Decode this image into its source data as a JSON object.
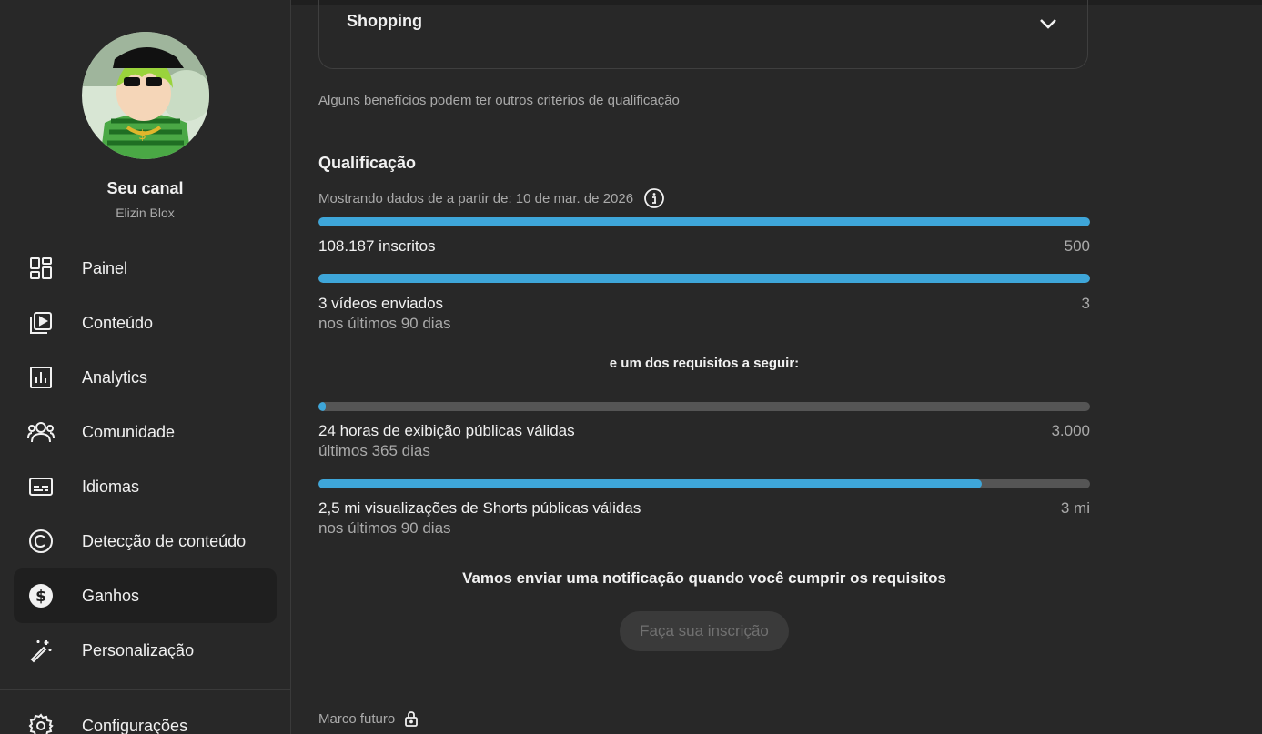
{
  "sidebar": {
    "channel_title": "Seu canal",
    "channel_name": "Elizin Blox",
    "items": [
      {
        "label": "Painel",
        "icon": "dashboard-icon"
      },
      {
        "label": "Conteúdo",
        "icon": "content-icon"
      },
      {
        "label": "Analytics",
        "icon": "analytics-icon"
      },
      {
        "label": "Comunidade",
        "icon": "community-icon"
      },
      {
        "label": "Idiomas",
        "icon": "subtitles-icon"
      },
      {
        "label": "Detecção de conteúdo",
        "icon": "copyright-icon"
      },
      {
        "label": "Ganhos",
        "icon": "dollar-icon",
        "active": true
      },
      {
        "label": "Personalização",
        "icon": "magic-wand-icon"
      },
      {
        "label": "Configurações",
        "icon": "gear-icon"
      }
    ]
  },
  "main": {
    "shopping_card": {
      "title": "Shopping"
    },
    "benefits_note": "Alguns benefícios podem ter outros critérios de qualificação",
    "qualification": {
      "title": "Qualificação",
      "date_line": "Mostrando dados de a partir de: 10 de mar. de 2026",
      "requirements": [
        {
          "label": "108.187 inscritos",
          "sub": "",
          "target": "500",
          "progress": 1.0
        },
        {
          "label": "3 vídeos enviados",
          "sub": "nos últimos 90 dias",
          "target": "3",
          "progress": 1.0
        }
      ],
      "one_of_text": "e um dos requisitos a seguir:",
      "optional_requirements": [
        {
          "label": "24 horas de exibição públicas válidas",
          "sub": "últimos 365 dias",
          "target": "3.000",
          "progress": 0.01
        },
        {
          "label": "2,5 mi visualizações de Shorts públicas válidas",
          "sub": "nos últimos 90 dias",
          "target": "3 mi",
          "progress": 0.86
        }
      ],
      "notify_text": "Vamos enviar uma notificação quando você cumprir os requisitos",
      "subscribe_button": "Faça sua inscrição"
    },
    "future_milestone": "Marco futuro"
  },
  "colors": {
    "background": "#282828",
    "progress": "#3ea6d9",
    "track": "#555555",
    "active_nav": "#1f1f1f"
  }
}
